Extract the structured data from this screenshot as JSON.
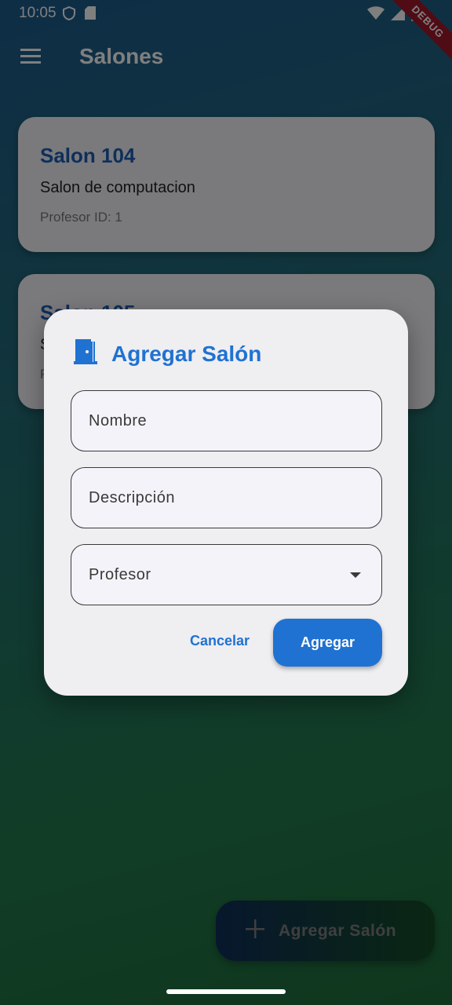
{
  "status_bar": {
    "time": "10:05",
    "debug_banner": "DEBUG"
  },
  "app_bar": {
    "title": "Salones"
  },
  "salones": [
    {
      "name": "Salon 104",
      "description": "Salon de computacion",
      "professor": "Profesor ID: 1"
    },
    {
      "name": "Salon 105",
      "description": "S",
      "professor": "P"
    }
  ],
  "dialog": {
    "title": "Agregar Salón",
    "fields": {
      "name_label": "Nombre",
      "description_label": "Descripción",
      "professor_label": "Profesor"
    },
    "cancel_label": "Cancelar",
    "submit_label": "Agregar"
  },
  "fab": {
    "label": "Agregar Salón"
  },
  "colors": {
    "accent": "#1f72d2",
    "card_title": "#1d5fb4",
    "background_top": "#1d5c8d",
    "background_bottom": "#1f6e3c"
  }
}
